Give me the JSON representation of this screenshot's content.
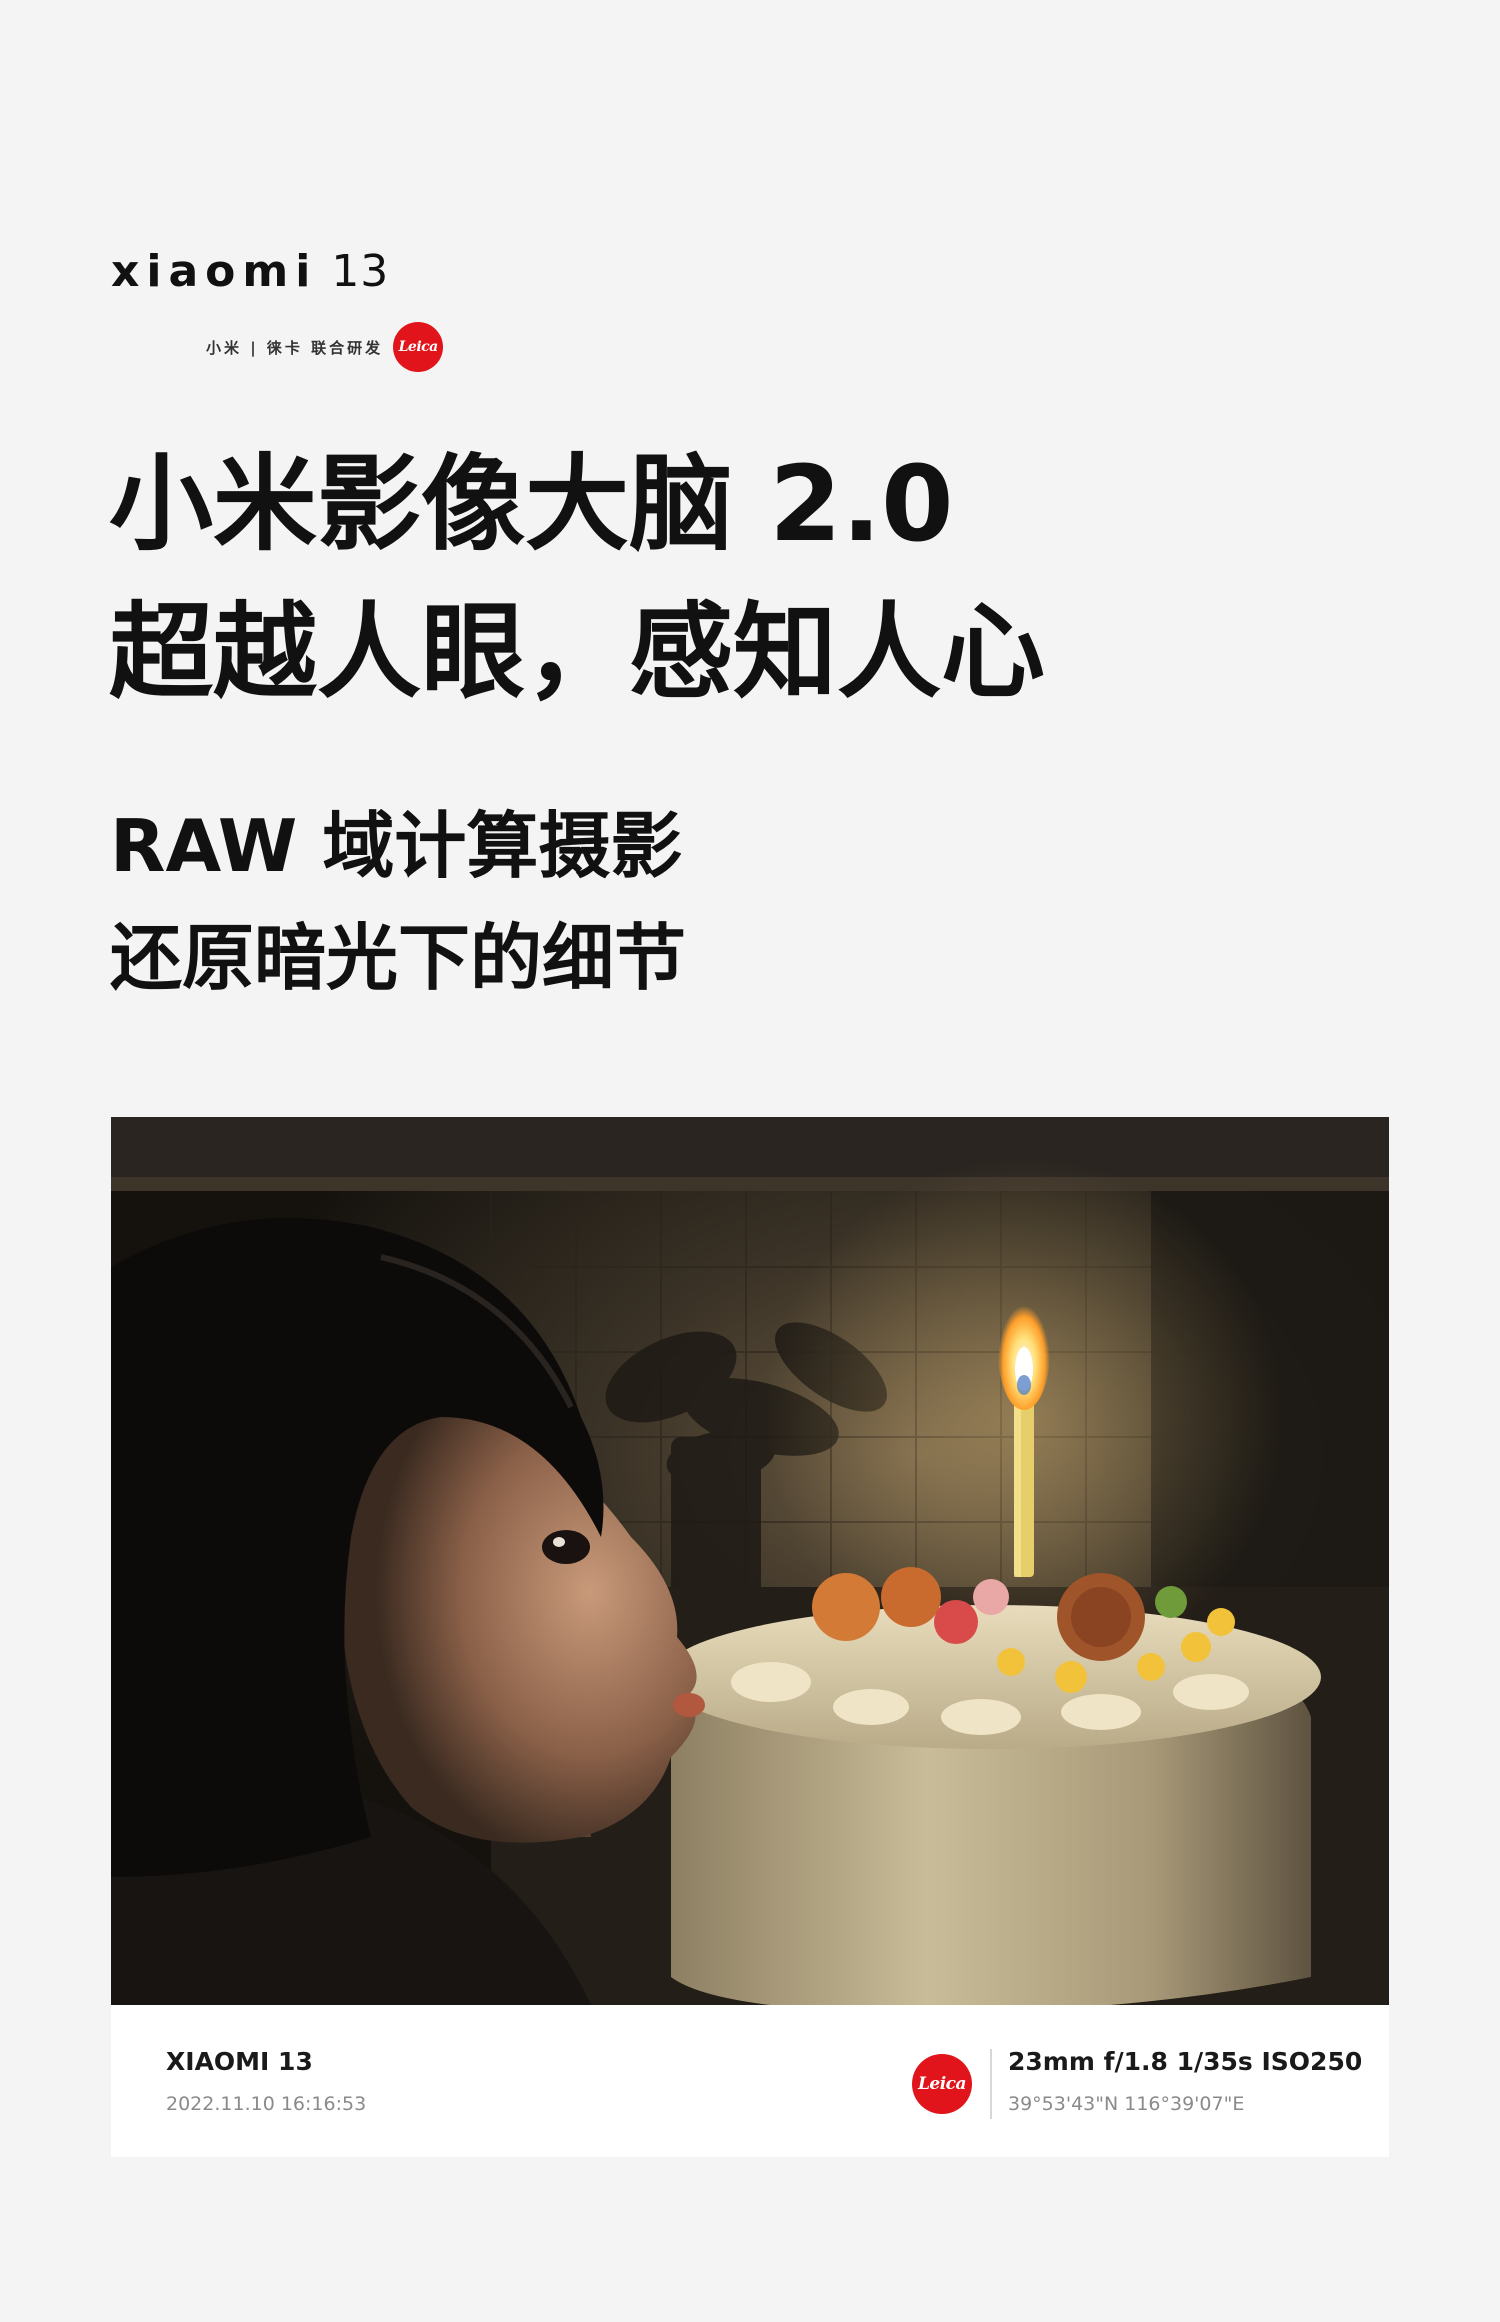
{
  "brand": {
    "name": "XIAOMI",
    "model": "13",
    "tagline": "小米 | 徕卡 联合研发",
    "leica_logo_text": "Leica",
    "leica_color": "#e1141b"
  },
  "headline": {
    "line1": "小米影像大脑 2.0",
    "line2": "超越人眼，感知人心"
  },
  "subhead": {
    "line1": "RAW 域计算摄影",
    "line2": "还原暗光下的细节"
  },
  "photo": {
    "subject": "photo-child-birthday-cake-candle"
  },
  "camera_info": {
    "model": "XIAOMI 13",
    "datetime": "2022.11.10 16:16:53",
    "leica_logo_text": "Leica",
    "exif": "23mm f/1.8 1/35s ISO250",
    "coordinates": "39°53'43\"N 116°39'07\"E"
  }
}
